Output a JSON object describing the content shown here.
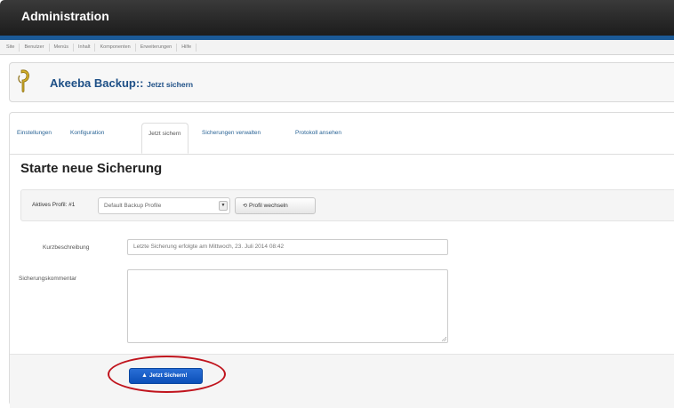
{
  "header": {
    "title": "Administration"
  },
  "menubar": {
    "items": [
      "Site",
      "Benutzer",
      "Menüs",
      "Inhalt",
      "Komponenten",
      "Erweiterungen",
      "Hilfe"
    ]
  },
  "toolbar": {
    "app_name": "Akeeba Backup::",
    "page_name": "Jetzt sichern",
    "logo_icon": "akeeba-logo-icon"
  },
  "tabs": [
    "Einstellungen",
    "Konfiguration",
    "Jetzt sichern",
    "Sicherungen verwalten",
    "Protokoll ansehen"
  ],
  "main": {
    "heading": "Starte neue Sicherung",
    "profile_label": "Aktives Profil: #1",
    "profile_select_value": "Default Backup Profile",
    "switch_profile_label": "Profil wechseln",
    "switch_profile_icon": "refresh-icon",
    "description_label": "Kurzbeschreibung",
    "description_value": "Letzte Sicherung erfolgte am Mittwoch, 23. Juli 2014 08:42",
    "comment_label": "Sicherungskommentar",
    "comment_value": "",
    "backup_button_label": "Jetzt Sichern!",
    "backup_button_icon": "backup-icon"
  },
  "colors": {
    "header": "#1c1c1c",
    "accent_bar": "#1b5a97",
    "primary_button": "#0b4fb8",
    "highlight": "#c0141d"
  }
}
